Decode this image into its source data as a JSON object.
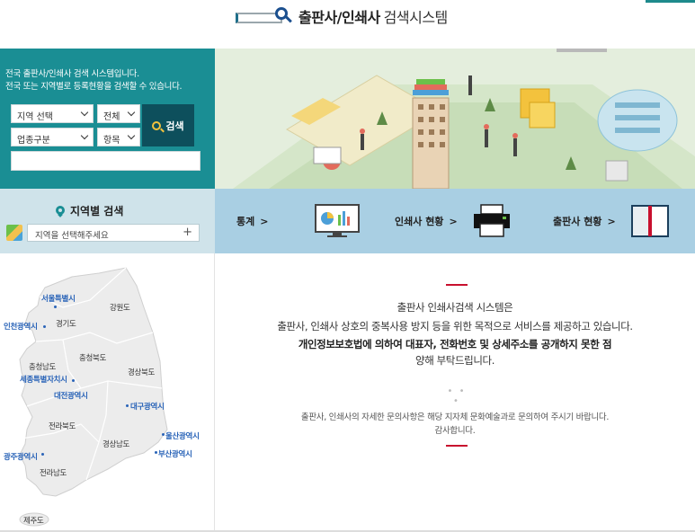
{
  "header": {
    "title_bold": "출판사/인쇄사",
    "title_light": "검색시스템"
  },
  "search": {
    "intro_line1": "전국 출판사/인쇄사 검색 시스템입니다.",
    "intro_line2": "전국 또는 지역별로 등록현황을 검색할 수 있습니다.",
    "region_select": "지역 선택",
    "scope_select": "전체",
    "category_select": "업종구분",
    "field_select": "항목",
    "search_button": "검색",
    "keyword_value": ""
  },
  "region_search": {
    "title": "지역별 검색",
    "select_placeholder": "지역을 선택해주세요",
    "plus": "+"
  },
  "map": {
    "labels": [
      {
        "text": "서울특별시",
        "city": true
      },
      {
        "text": "인천광역시",
        "city": true
      },
      {
        "text": "경기도",
        "city": false
      },
      {
        "text": "강원도",
        "city": false
      },
      {
        "text": "충청북도",
        "city": false
      },
      {
        "text": "충청남도",
        "city": false
      },
      {
        "text": "세종특별자치시",
        "city": true
      },
      {
        "text": "대전광역시",
        "city": true
      },
      {
        "text": "경상북도",
        "city": false
      },
      {
        "text": "대구광역시",
        "city": true
      },
      {
        "text": "전라북도",
        "city": false
      },
      {
        "text": "울산광역시",
        "city": true
      },
      {
        "text": "경상남도",
        "city": false
      },
      {
        "text": "부산광역시",
        "city": true
      },
      {
        "text": "광주광역시",
        "city": true
      },
      {
        "text": "전라남도",
        "city": false
      },
      {
        "text": "제주도",
        "city": false
      }
    ]
  },
  "menus": [
    {
      "label": "통계",
      "arrow": ">",
      "icon": "statistics-monitor-icon"
    },
    {
      "label": "인쇄사 현황",
      "arrow": ">",
      "icon": "printer-icon"
    },
    {
      "label": "출판사 현황",
      "arrow": ">",
      "icon": "book-icon"
    }
  ],
  "notice": {
    "line1": "출판사 인쇄사검색 시스템은",
    "line2": "출판사, 인쇄사 상호의 중복사용 방지 등을 위한 목적으로 서비스를 제공하고 있습니다.",
    "line3": "개인정보보호법에 의하여 대표자, 전화번호 및 상세주소를 공개하지 못한 점",
    "line4": "양해 부탁드립니다.",
    "dots": "• • •",
    "small1": "출판사, 인쇄사의 자세한 문의사항은 해당 지자체 문화예술과로 문의하여 주시기 바랍니다.",
    "small2": "감사합니다."
  },
  "colors": {
    "teal": "#1a8e94",
    "dark_teal": "#0d4f5c",
    "menu_blue": "#a9cfe3",
    "region_bg": "#cfe3ea",
    "accent_red": "#c8102e",
    "city_blue": "#2a64b8"
  }
}
